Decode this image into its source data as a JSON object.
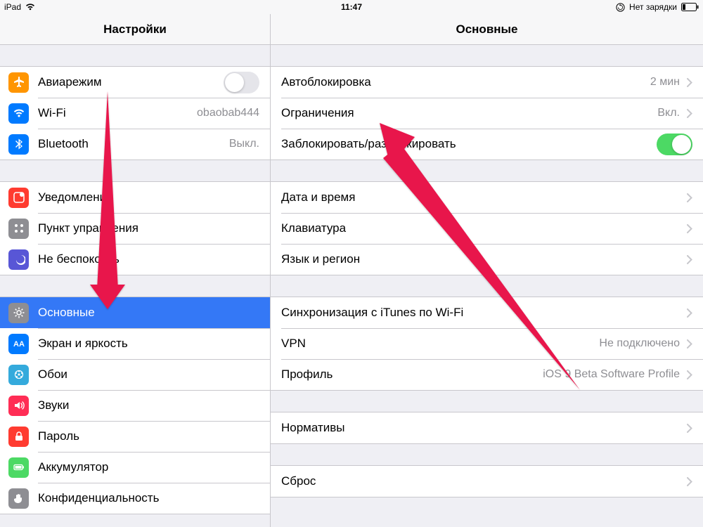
{
  "statusbar": {
    "device": "iPad",
    "time": "11:47",
    "charging_text": "Нет зарядки"
  },
  "sidebar": {
    "title": "Настройки",
    "group1": {
      "airplane": {
        "label": "Авиарежим"
      },
      "wifi": {
        "label": "Wi-Fi",
        "value": "obaobab444"
      },
      "bluetooth": {
        "label": "Bluetooth",
        "value": "Выкл."
      }
    },
    "group2": {
      "notifications": {
        "label": "Уведомления"
      },
      "control_center": {
        "label": "Пункт управления"
      },
      "dnd": {
        "label": "Не беспокоить"
      }
    },
    "group3": {
      "general": {
        "label": "Основные"
      },
      "display": {
        "label": "Экран и яркость"
      },
      "wallpaper": {
        "label": "Обои"
      },
      "sounds": {
        "label": "Звуки"
      },
      "passcode": {
        "label": "Пароль"
      },
      "battery": {
        "label": "Аккумулятор"
      },
      "privacy": {
        "label": "Конфиденциальность"
      }
    }
  },
  "detail": {
    "title": "Основные",
    "group1": {
      "autolock": {
        "label": "Автоблокировка",
        "value": "2 мин"
      },
      "restrictions": {
        "label": "Ограничения",
        "value": "Вкл."
      },
      "lock_unlock": {
        "label": "Заблокировать/разблокировать"
      }
    },
    "group2": {
      "date_time": {
        "label": "Дата и время"
      },
      "keyboard": {
        "label": "Клавиатура"
      },
      "language": {
        "label": "Язык и регион"
      }
    },
    "group3": {
      "itunes_sync": {
        "label": "Синхронизация с iTunes по Wi-Fi"
      },
      "vpn": {
        "label": "VPN",
        "value": "Не подключено"
      },
      "profile": {
        "label": "Профиль",
        "value": "iOS 9 Beta Software Profile"
      }
    },
    "group4": {
      "regulatory": {
        "label": "Нормативы"
      }
    },
    "group5": {
      "reset": {
        "label": "Сброс"
      }
    }
  },
  "colors": {
    "selection": "#3478f6",
    "arrow": "#e91e63",
    "icon_orange": "#ff9500",
    "icon_blue": "#007aff",
    "icon_red": "#ff3b30",
    "icon_darkred": "#ff2d55",
    "icon_gray": "#8e8e93",
    "icon_purple": "#5856d6",
    "icon_cyan": "#34aadc",
    "icon_green": "#4cd964"
  }
}
